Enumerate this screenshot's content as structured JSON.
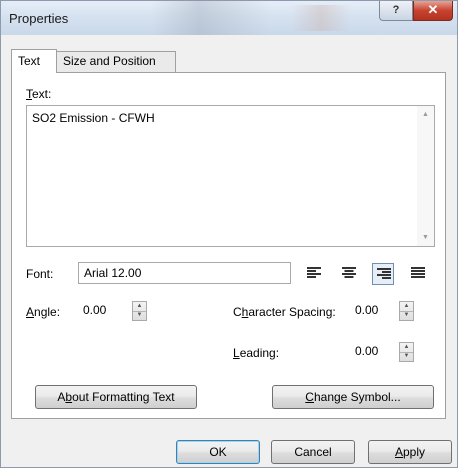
{
  "window": {
    "title": "Properties",
    "help_glyph": "?",
    "close_glyph": "✕"
  },
  "tabs": [
    {
      "label": "Text",
      "active": true
    },
    {
      "label": "Size and Position",
      "active": false
    }
  ],
  "text_section": {
    "label_mnemonic": "T",
    "label_rest": "ext:",
    "value": "SO2 Emission - CFWH"
  },
  "font": {
    "label": "Font:",
    "value": "Arial 12.00"
  },
  "alignment": {
    "options": [
      "align-left",
      "align-center",
      "align-right",
      "justify"
    ],
    "selected": "align-right"
  },
  "angle": {
    "label_mnemonic": "A",
    "label_rest": "ngle:",
    "value": "0.00"
  },
  "character_spacing": {
    "label_pre": "C",
    "label_mnemonic": "h",
    "label_rest": "aracter Spacing:",
    "value": "0.00"
  },
  "leading": {
    "label_mnemonic": "L",
    "label_rest": "eading:",
    "value": "0.00"
  },
  "buttons": {
    "about_pre": "A",
    "about_mnemonic": "b",
    "about_rest": "out Formatting Text",
    "change_mnemonic": "C",
    "change_rest": "hange Symbol...",
    "ok": "OK",
    "cancel": "Cancel",
    "apply_mnemonic": "A",
    "apply_rest": "pply"
  },
  "colors": {
    "titlebar": "#d6e2f0",
    "close": "#c7432f",
    "default_border": "#3c7fb1"
  }
}
